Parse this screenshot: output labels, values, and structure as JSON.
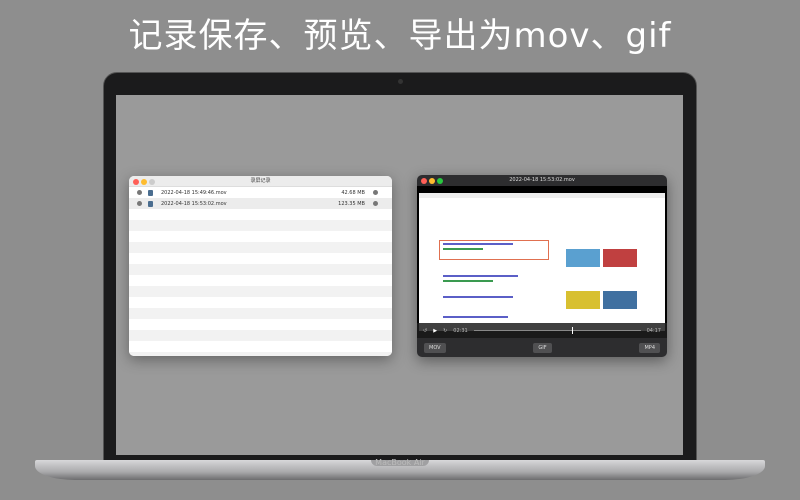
{
  "headline": "记录保存、预览、导出为mov、gif",
  "device_label": "MacBook Air",
  "records_window": {
    "title": "录屏记录",
    "rows": [
      {
        "name": "2022-04-18 15:49:46.mov",
        "size": "42.68 MB"
      },
      {
        "name": "2022-04-18 15:53:02.mov",
        "size": "123.35 MB"
      }
    ]
  },
  "preview_window": {
    "title": "2022-04-18 15:53:02.mov",
    "current_time": "02:31",
    "total_time": "04:17",
    "progress_percent": 59,
    "buttons": {
      "mov": "MOV",
      "gif": "GIF",
      "mp4": "MP4"
    }
  }
}
